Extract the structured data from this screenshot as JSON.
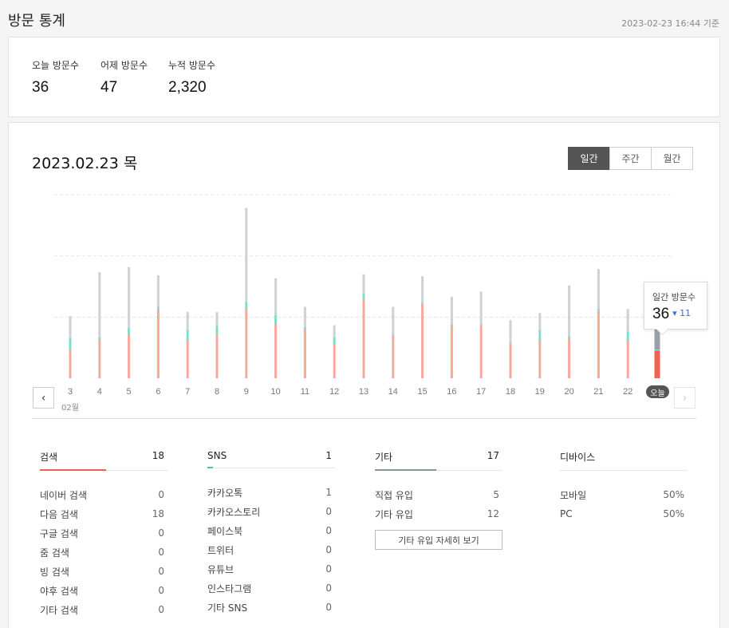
{
  "header": {
    "title": "방문 통계",
    "timestamp": "2023-02-23 16:44 기준"
  },
  "summary": {
    "today_label": "오늘 방문수",
    "today_value": "36",
    "yesterday_label": "어제 방문수",
    "yesterday_value": "47",
    "total_label": "누적 방문수",
    "total_value": "2,320"
  },
  "main": {
    "date": "2023.02.23 목",
    "tabs": [
      {
        "label": "일간",
        "active": true
      },
      {
        "label": "주간",
        "active": false
      },
      {
        "label": "월간",
        "active": false
      }
    ],
    "month_label": "02월",
    "today_label": "오늘",
    "tooltip": {
      "label": "일간 방문수",
      "value": "36",
      "change": "▾ 11"
    },
    "prev_icon": "‹",
    "next_icon": "›"
  },
  "chart_data": {
    "type": "bar",
    "categories": [
      "3",
      "4",
      "5",
      "6",
      "7",
      "8",
      "9",
      "10",
      "11",
      "12",
      "13",
      "14",
      "15",
      "16",
      "17",
      "18",
      "19",
      "20",
      "21",
      "22",
      "오늘"
    ],
    "series": [
      {
        "name": "검색",
        "color": "#f4a99c",
        "values": [
          28,
          38,
          43,
          68,
          37,
          43,
          68,
          54,
          48,
          33,
          77,
          42,
          73,
          53,
          52,
          34,
          37,
          39,
          66,
          37,
          27
        ]
      },
      {
        "name": "SNS",
        "color": "#7fdcc8",
        "values": [
          12,
          2,
          6,
          2,
          10,
          8,
          7,
          8,
          2,
          7,
          6,
          1,
          1,
          0,
          1,
          1,
          10,
          2,
          2,
          9,
          1
        ]
      },
      {
        "name": "기타",
        "color": "#cdd0d5",
        "values": [
          21,
          64,
          60,
          31,
          18,
          14,
          92,
          36,
          20,
          12,
          19,
          27,
          26,
          27,
          32,
          22,
          17,
          50,
          39,
          22,
          26
        ]
      }
    ],
    "highlight_index": 20,
    "highlight_colors": {
      "검색": "#f26052",
      "SNS": "#7fdcc8",
      "기타": "#9aa0a9"
    },
    "ylim": [
      0,
      180
    ],
    "grid": true
  },
  "sections": {
    "search": {
      "title": "검색",
      "count": "18",
      "underline_color": "#f26052",
      "items": [
        {
          "label": "네이버 검색",
          "value": "0"
        },
        {
          "label": "다음 검색",
          "value": "18"
        },
        {
          "label": "구글 검색",
          "value": "0"
        },
        {
          "label": "줌 검색",
          "value": "0"
        },
        {
          "label": "빙 검색",
          "value": "0"
        },
        {
          "label": "야후 검색",
          "value": "0"
        },
        {
          "label": "기타 검색",
          "value": "0"
        }
      ]
    },
    "sns": {
      "title": "SNS",
      "count": "1",
      "underline_color": "#3fc8b0",
      "items": [
        {
          "label": "카카오톡",
          "value": "1"
        },
        {
          "label": "카카오스토리",
          "value": "0"
        },
        {
          "label": "페이스북",
          "value": "0"
        },
        {
          "label": "트위터",
          "value": "0"
        },
        {
          "label": "유튜브",
          "value": "0"
        },
        {
          "label": "인스타그램",
          "value": "0"
        },
        {
          "label": "기타 SNS",
          "value": "0"
        }
      ]
    },
    "other": {
      "title": "기타",
      "count": "17",
      "underline_color": "#8a929c",
      "items": [
        {
          "label": "직접 유입",
          "value": "5"
        },
        {
          "label": "기타 유입",
          "value": "12"
        }
      ],
      "detail_button": "기타 유입 자세히 보기"
    },
    "device": {
      "title": "디바이스",
      "items": [
        {
          "label": "모바일",
          "value": "50%"
        },
        {
          "label": "PC",
          "value": "50%"
        }
      ]
    }
  }
}
